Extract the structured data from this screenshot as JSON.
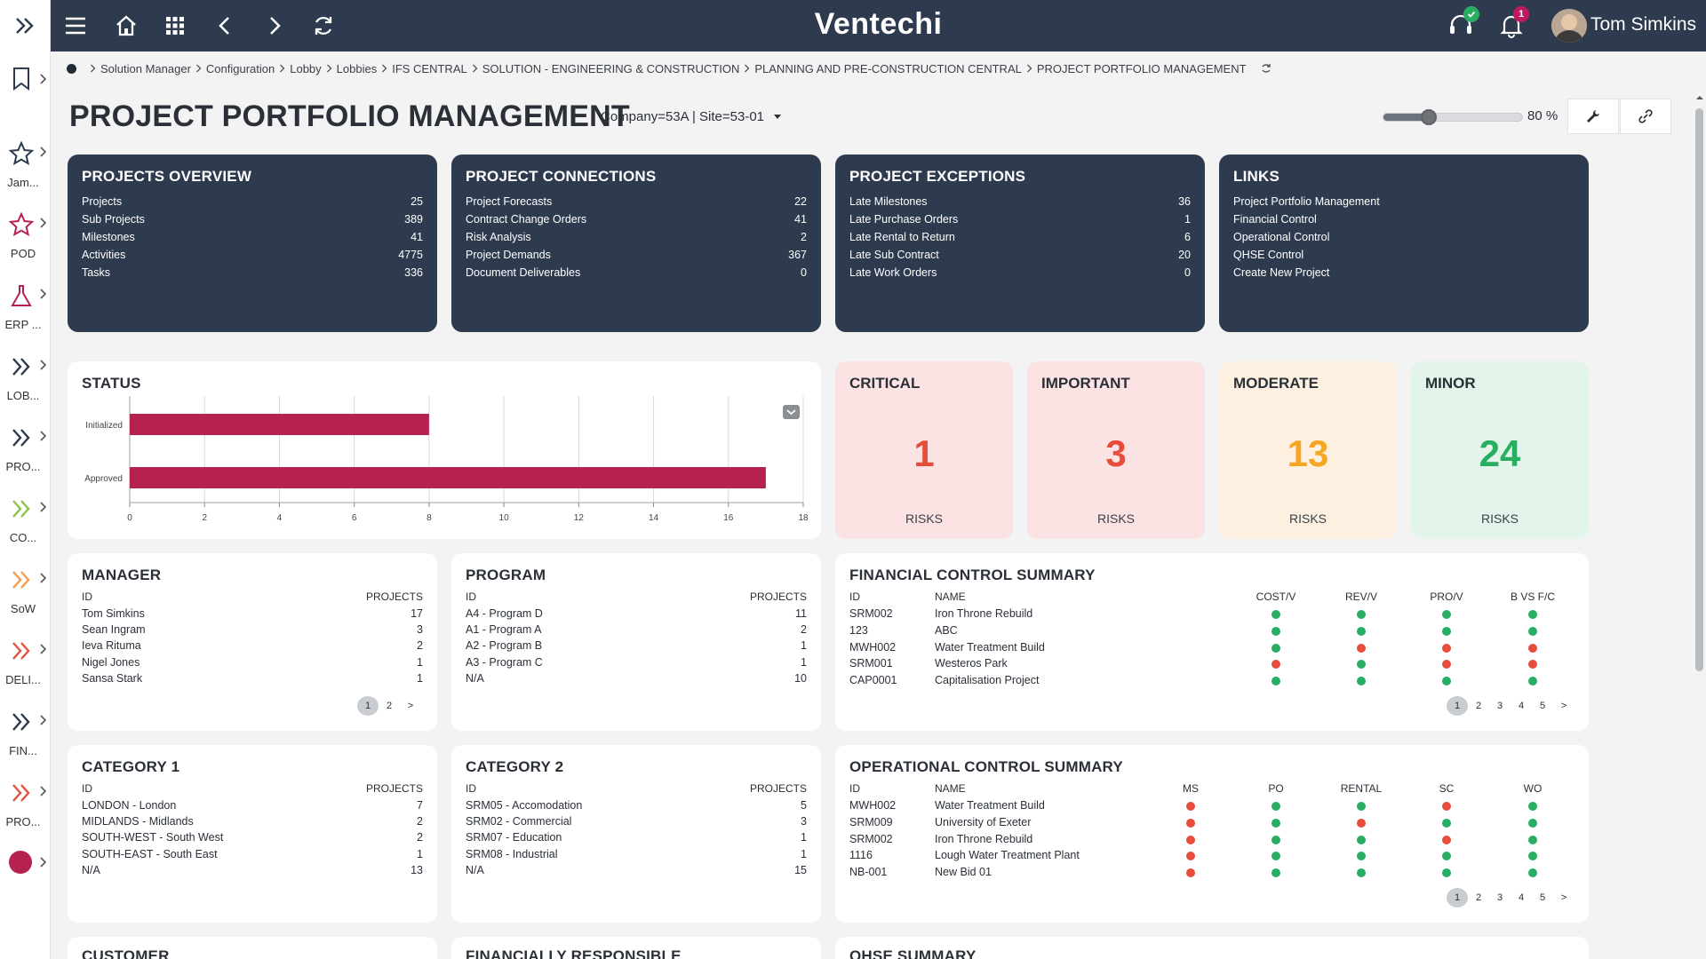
{
  "rail": {
    "items": [
      {
        "label": "Jam...",
        "icon": "star-icon"
      },
      {
        "label": "POD",
        "icon": "star-icon"
      },
      {
        "label": "ERP ...",
        "icon": "flask-icon"
      },
      {
        "label": "LOB...",
        "icon": "double-chevron-icon"
      },
      {
        "label": "PRO...",
        "icon": "double-chevron-icon"
      },
      {
        "label": "CO...",
        "icon": "double-chevron-icon"
      },
      {
        "label": "SoW",
        "icon": "double-chevron-icon"
      },
      {
        "label": "DELI...",
        "icon": "double-chevron-icon"
      },
      {
        "label": "FIN...",
        "icon": "double-chevron-icon"
      },
      {
        "label": "PRO...",
        "icon": "double-chevron-icon"
      }
    ]
  },
  "topbar": {
    "brand": "Ventechi",
    "notifications_count": "1",
    "user_name": "Tom Simkins"
  },
  "breadcrumb": [
    "Solution Manager",
    "Configuration",
    "Lobby",
    "Lobbies",
    "IFS CENTRAL",
    "SOLUTION - ENGINEERING & CONSTRUCTION",
    "PLANNING AND PRE-CONSTRUCTION CENTRAL",
    "PROJECT PORTFOLIO MANAGEMENT"
  ],
  "page": {
    "title": "PROJECT PORTFOLIO MANAGEMENT",
    "context": "Company=53A | Site=53-01",
    "zoom_label": "80 %",
    "zoom_percent": 80
  },
  "overview": {
    "title": "PROJECTS OVERVIEW",
    "rows": [
      {
        "label": "Projects",
        "value": "25"
      },
      {
        "label": "Sub Projects",
        "value": "389"
      },
      {
        "label": "Milestones",
        "value": "41"
      },
      {
        "label": "Activities",
        "value": "4775"
      },
      {
        "label": "Tasks",
        "value": "336"
      }
    ]
  },
  "connections": {
    "title": "PROJECT CONNECTIONS",
    "rows": [
      {
        "label": "Project Forecasts",
        "value": "22"
      },
      {
        "label": "Contract Change Orders",
        "value": "41"
      },
      {
        "label": "Risk Analysis",
        "value": "2"
      },
      {
        "label": "Project Demands",
        "value": "367"
      },
      {
        "label": "Document Deliverables",
        "value": "0"
      }
    ]
  },
  "exceptions": {
    "title": "PROJECT EXCEPTIONS",
    "rows": [
      {
        "label": "Late Milestones",
        "value": "36"
      },
      {
        "label": "Late Purchase Orders",
        "value": "1"
      },
      {
        "label": "Late Rental to Return",
        "value": "6"
      },
      {
        "label": "Late Sub Contract",
        "value": "20"
      },
      {
        "label": "Late Work Orders",
        "value": "0"
      }
    ]
  },
  "links": {
    "title": "LINKS",
    "rows": [
      "Project Portfolio Management",
      "Financial Control",
      "Operational Control",
      "QHSE Control",
      "Create New Project"
    ]
  },
  "status": {
    "title": "STATUS"
  },
  "chart_data": {
    "type": "bar",
    "orientation": "horizontal",
    "categories": [
      "Initialized",
      "Approved"
    ],
    "values": [
      8,
      17
    ],
    "xlim": [
      0,
      18
    ],
    "xticks": [
      "0",
      "2",
      "4",
      "6",
      "8",
      "10",
      "12",
      "14",
      "16",
      "18"
    ],
    "grid": true,
    "bar_color": "#b5224f"
  },
  "risks": [
    {
      "title": "CRITICAL",
      "value": "1",
      "label": "RISKS",
      "bg": "#fbe3e4",
      "color": "#e74c3c"
    },
    {
      "title": "IMPORTANT",
      "value": "3",
      "label": "RISKS",
      "bg": "#fbe3e4",
      "color": "#e74c3c"
    },
    {
      "title": "MODERATE",
      "value": "13",
      "label": "RISKS",
      "bg": "#fdf0e1",
      "color": "#f5a623"
    },
    {
      "title": "MINOR",
      "value": "24",
      "label": "RISKS",
      "bg": "#e3f4ea",
      "color": "#27ae60"
    }
  ],
  "manager": {
    "title": "MANAGER",
    "col_id": "ID",
    "col_projects": "PROJECTS",
    "rows": [
      {
        "id": "Tom Simkins",
        "projects": "17"
      },
      {
        "id": "Sean Ingram",
        "projects": "3"
      },
      {
        "id": "Ieva Rituma",
        "projects": "2"
      },
      {
        "id": "Nigel Jones",
        "projects": "1"
      },
      {
        "id": "Sansa Stark",
        "projects": "1"
      }
    ],
    "pages": [
      "1",
      "2",
      ">"
    ]
  },
  "program": {
    "title": "PROGRAM",
    "col_id": "ID",
    "col_projects": "PROJECTS",
    "rows": [
      {
        "id": "A4 - Program D",
        "projects": "11"
      },
      {
        "id": "A1 - Program A",
        "projects": "2"
      },
      {
        "id": "A2 - Program B",
        "projects": "1"
      },
      {
        "id": "A3 - Program C",
        "projects": "1"
      },
      {
        "id": "N/A",
        "projects": "10"
      }
    ]
  },
  "financial": {
    "title": "FINANCIAL CONTROL SUMMARY",
    "cols": [
      "ID",
      "NAME",
      "COST/V",
      "REV/V",
      "PRO/V",
      "B VS F/C"
    ],
    "rows": [
      {
        "id": "SRM002",
        "name": "Iron Throne Rebuild",
        "s": [
          "g",
          "g",
          "g",
          "g"
        ]
      },
      {
        "id": "123",
        "name": "ABC",
        "s": [
          "g",
          "g",
          "g",
          "g"
        ]
      },
      {
        "id": "MWH002",
        "name": "Water Treatment Build",
        "s": [
          "g",
          "r",
          "r",
          "r"
        ]
      },
      {
        "id": "SRM001",
        "name": "Westeros Park",
        "s": [
          "r",
          "g",
          "r",
          "r"
        ]
      },
      {
        "id": "CAP0001",
        "name": "Capitalisation Project",
        "s": [
          "g",
          "g",
          "g",
          "g"
        ]
      }
    ],
    "pages": [
      "1",
      "2",
      "3",
      "4",
      "5",
      ">"
    ]
  },
  "category1": {
    "title": "CATEGORY 1",
    "col_id": "ID",
    "col_projects": "PROJECTS",
    "rows": [
      {
        "id": "LONDON - London",
        "projects": "7"
      },
      {
        "id": "MIDLANDS - Midlands",
        "projects": "2"
      },
      {
        "id": "SOUTH-WEST - South West",
        "projects": "2"
      },
      {
        "id": "SOUTH-EAST - South East",
        "projects": "1"
      },
      {
        "id": "N/A",
        "projects": "13"
      }
    ]
  },
  "category2": {
    "title": "CATEGORY 2",
    "col_id": "ID",
    "col_projects": "PROJECTS",
    "rows": [
      {
        "id": "SRM05 - Accomodation",
        "projects": "5"
      },
      {
        "id": "SRM02 - Commercial",
        "projects": "3"
      },
      {
        "id": "SRM07 - Education",
        "projects": "1"
      },
      {
        "id": "SRM08 - Industrial",
        "projects": "1"
      },
      {
        "id": "N/A",
        "projects": "15"
      }
    ]
  },
  "operational": {
    "title": "OPERATIONAL CONTROL SUMMARY",
    "cols": [
      "ID",
      "NAME",
      "MS",
      "PO",
      "RENTAL",
      "SC",
      "WO"
    ],
    "rows": [
      {
        "id": "MWH002",
        "name": "Water Treatment Build",
        "s": [
          "r",
          "g",
          "g",
          "r",
          "g"
        ]
      },
      {
        "id": "SRM009",
        "name": "University of Exeter",
        "s": [
          "r",
          "g",
          "r",
          "g",
          "g"
        ]
      },
      {
        "id": "SRM002",
        "name": "Iron Throne Rebuild",
        "s": [
          "r",
          "g",
          "g",
          "r",
          "g"
        ]
      },
      {
        "id": "1116",
        "name": "Lough Water Treatment Plant",
        "s": [
          "r",
          "g",
          "g",
          "g",
          "g"
        ]
      },
      {
        "id": "NB-001",
        "name": "New Bid 01",
        "s": [
          "r",
          "g",
          "g",
          "g",
          "g"
        ]
      }
    ],
    "pages": [
      "1",
      "2",
      "3",
      "4",
      "5",
      ">"
    ]
  },
  "bottom": {
    "customer": "CUSTOMER",
    "financially_responsible": "FINANCIALLY RESPONSIBLE",
    "qhse": "QHSE SUMMARY"
  }
}
